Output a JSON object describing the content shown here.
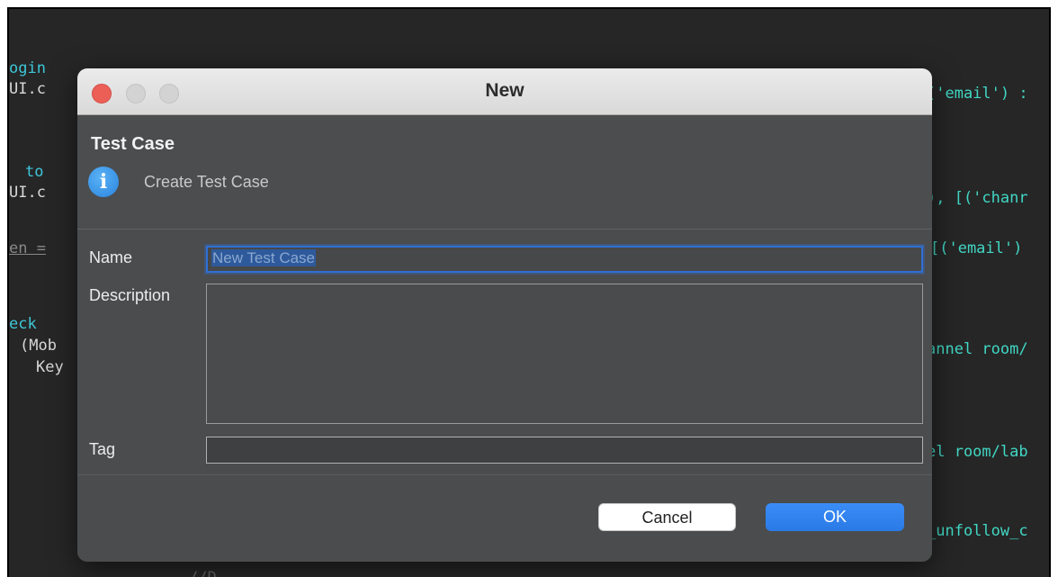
{
  "background_code": {
    "left_fragments": [
      "ogin",
      "UI.c",
      "to",
      "UI.c",
      "en =",
      "eck",
      "(Mob",
      "Key"
    ],
    "right_fragments": [
      "('email') :",
      "), [('chanr",
      "[('email')",
      "annel room/",
      "el room/lab",
      "_unfollow_c"
    ],
    "bottom_fragment": "//D..."
  },
  "dialog": {
    "title": "New",
    "section_title": "Test Case",
    "info_text": "Create Test Case",
    "fields": {
      "name_label": "Name",
      "name_value": "New Test Case",
      "description_label": "Description",
      "description_value": "",
      "tag_label": "Tag",
      "tag_value": ""
    },
    "buttons": {
      "cancel": "Cancel",
      "ok": "OK"
    }
  },
  "colors": {
    "accent": "#2a7ae6",
    "close": "#ec5f57",
    "dialog_bg": "#4a4c4e",
    "editor_bg": "#262626",
    "string": "#41d7c4"
  }
}
